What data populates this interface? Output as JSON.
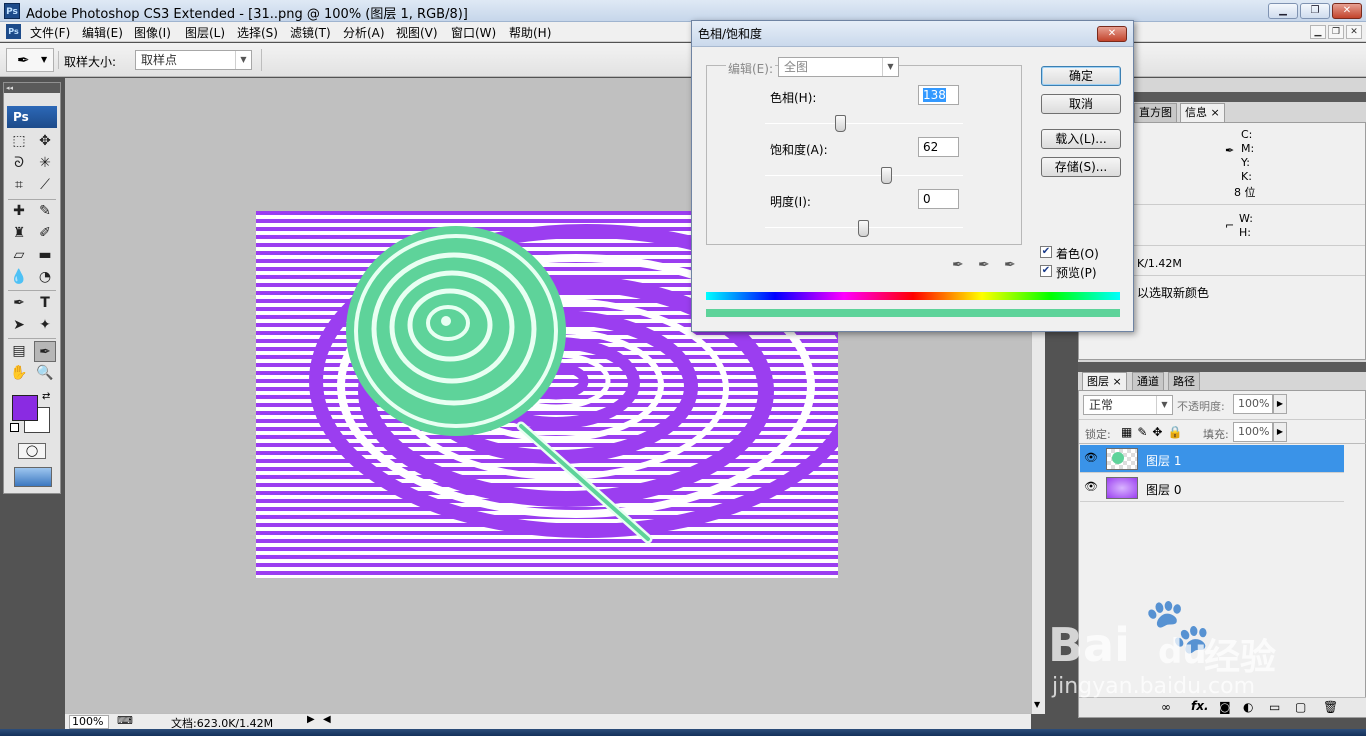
{
  "window": {
    "title": "Adobe Photoshop CS3 Extended - [31..png @ 100% (图层 1, RGB/8)]",
    "ps_badge": "Ps"
  },
  "menu": [
    "文件(F)",
    "编辑(E)",
    "图像(I)",
    "图层(L)",
    "选择(S)",
    "滤镜(T)",
    "分析(A)",
    "视图(V)",
    "窗口(W)",
    "帮助(H)"
  ],
  "options": {
    "sample_label": "取样大小:",
    "sample_value": "取样点"
  },
  "colors": {
    "foreground": "#8a2be2",
    "background": "#ffffff",
    "lollipop": "#5ed39a",
    "swirl": "#9b3ef0"
  },
  "dialog": {
    "title": "色相/饱和度",
    "edit_label": "编辑(E):",
    "edit_value": "全图",
    "hue_label": "色相(H):",
    "hue_value": "138",
    "sat_label": "饱和度(A):",
    "sat_value": "62",
    "light_label": "明度(I):",
    "light_value": "0",
    "ok": "确定",
    "cancel": "取消",
    "load": "载入(L)...",
    "save": "存储(S)...",
    "colorize": "着色(O)",
    "preview": "预览(P)"
  },
  "info_panel": {
    "tabs": [
      "直方图",
      "信息"
    ],
    "cmyk": [
      "C:",
      "M:",
      "Y:",
      "K:"
    ],
    "bit": "8 位",
    "wh": [
      "W:",
      "H:"
    ],
    "doc": "K/1.42M",
    "hint": "以选取新颜色"
  },
  "layers_panel": {
    "tabs": [
      "图层",
      "通道",
      "路径"
    ],
    "blend": "正常",
    "opacity_label": "不透明度:",
    "opacity": "100%",
    "lock_label": "锁定:",
    "fill_label": "填充:",
    "fill": "100%",
    "layers": [
      "图层 1",
      "图层 0"
    ]
  },
  "status": {
    "zoom": "100%",
    "doc": "文档:623.0K/1.42M"
  },
  "watermark": {
    "brand": "Bai",
    "brand2": "du",
    "cn": "经验",
    "url": "jingyan.baidu.com"
  }
}
